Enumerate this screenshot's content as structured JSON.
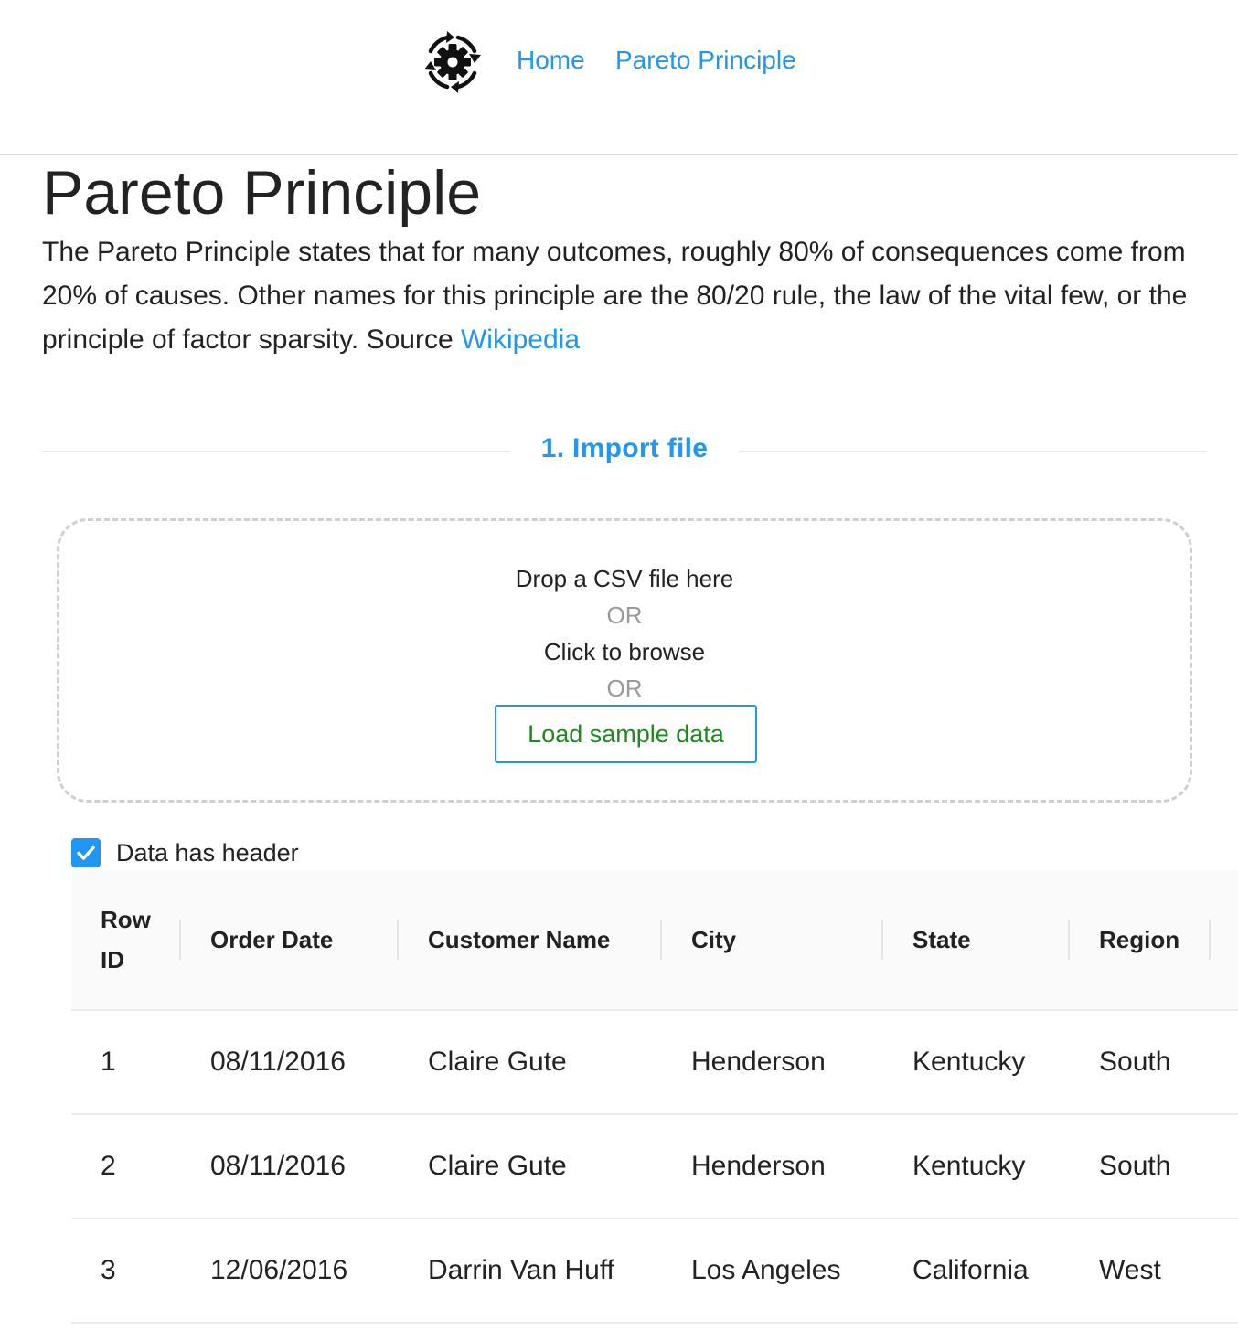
{
  "nav": {
    "logo_icon": "gear-cycle-icon",
    "home_label": "Home",
    "pareto_label": "Pareto Principle"
  },
  "page": {
    "title": "Pareto Principle",
    "intro_text": "The Pareto Principle states that for many outcomes, roughly 80% of consequences come from 20% of causes. Other names for this principle are the 80/20 rule, the law of the vital few, or the principle of factor sparsity.  Source ",
    "source_link": "Wikipedia"
  },
  "import": {
    "section_title": "1. Import file",
    "drop_text": "Drop a CSV file here",
    "or_text_1": "OR",
    "browse_text": "Click to browse",
    "or_text_2": "OR",
    "load_button": "Load sample data",
    "header_checkbox_label": "Data has header",
    "header_checked": true
  },
  "table": {
    "columns": [
      "Row ID",
      "Order Date",
      "Customer Name",
      "City",
      "State",
      "Region"
    ],
    "rows": [
      [
        "1",
        "08/11/2016",
        "Claire Gute",
        "Henderson",
        "Kentucky",
        "South"
      ],
      [
        "2",
        "08/11/2016",
        "Claire Gute",
        "Henderson",
        "Kentucky",
        "South"
      ],
      [
        "3",
        "12/06/2016",
        "Darrin Van Huff",
        "Los Angeles",
        "California",
        "West"
      ]
    ]
  },
  "colors": {
    "accent": "#2196f3",
    "load_button_text": "#1e8a1e",
    "muted": "#9a9a9a"
  }
}
